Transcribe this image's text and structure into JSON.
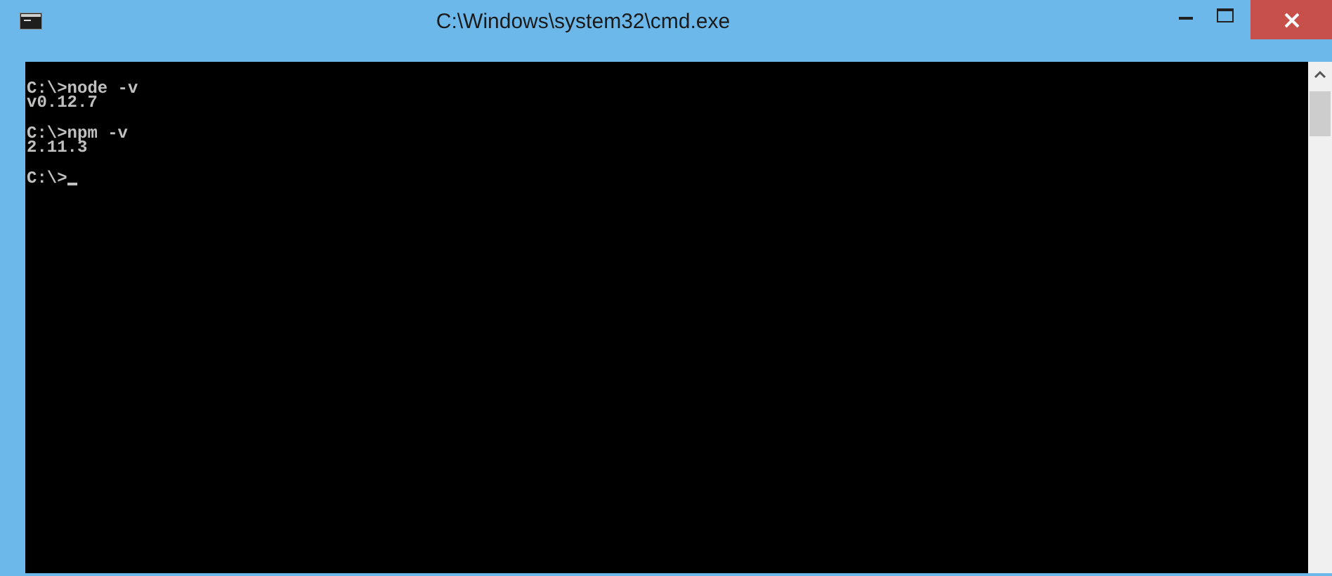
{
  "window": {
    "title": "C:\\Windows\\system32\\cmd.exe"
  },
  "console": {
    "blocks": [
      {
        "lines": [
          "C:\\>node -v",
          "v0.12.7"
        ]
      },
      {
        "lines": [
          "C:\\>npm -v",
          "2.11.3"
        ]
      }
    ],
    "prompt": "C:\\>"
  }
}
